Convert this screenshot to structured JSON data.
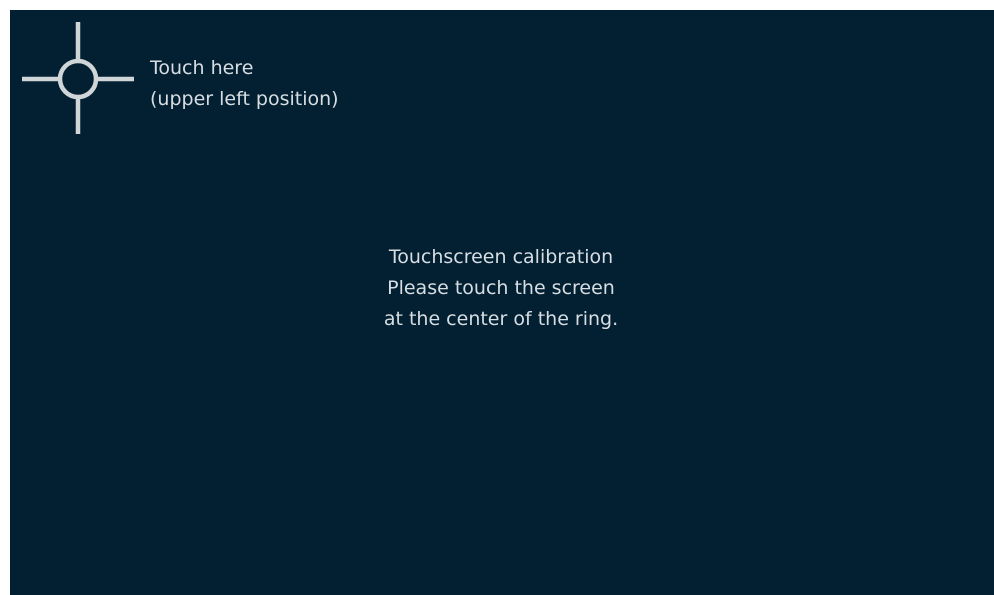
{
  "calibration": {
    "target": {
      "icon": "crosshair-ring-icon",
      "label_line1": "Touch here",
      "label_line2": "(upper left position)"
    },
    "message": {
      "line1": "Touchscreen calibration",
      "line2": "Please touch the screen",
      "line3": "at the center of the ring."
    }
  },
  "colors": {
    "background": "#022032",
    "foreground": "#d7dde2",
    "crosshair": "#d0d5d8"
  }
}
